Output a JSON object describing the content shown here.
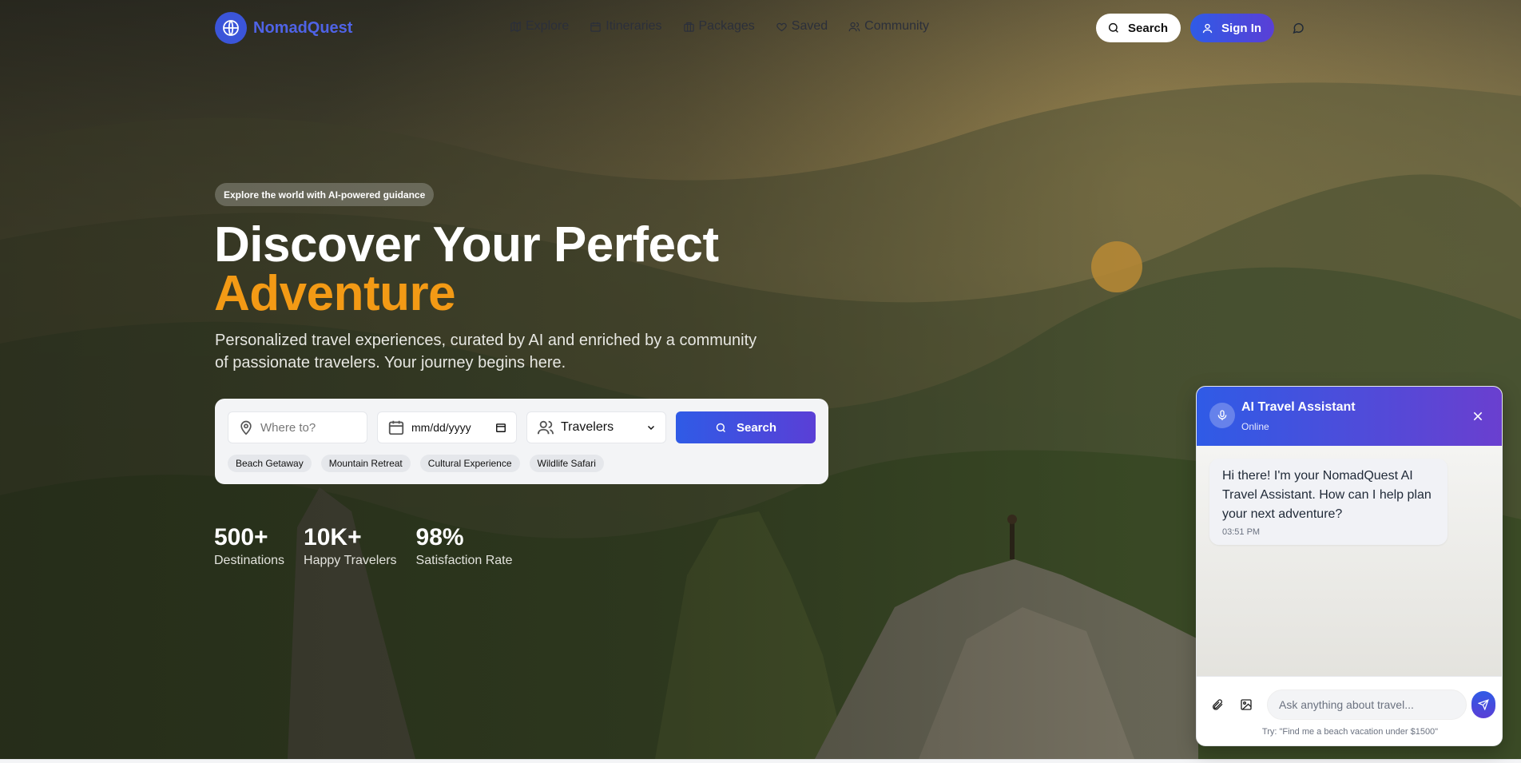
{
  "brand": {
    "name": "NomadQuest"
  },
  "nav": {
    "links": [
      {
        "label": "Explore",
        "icon": "map-icon"
      },
      {
        "label": "Itineraries",
        "icon": "calendar-icon"
      },
      {
        "label": "Packages",
        "icon": "briefcase-icon"
      },
      {
        "label": "Saved",
        "icon": "heart-icon"
      },
      {
        "label": "Community",
        "icon": "users-icon"
      }
    ],
    "search_label": "Search",
    "signin_label": "Sign In"
  },
  "hero": {
    "tagline": "Explore the world with AI-powered guidance",
    "headline_line1": "Discover Your Perfect",
    "headline_accent": "Adventure",
    "subhead": "Personalized travel experiences, curated by AI and enriched by a community of passionate travelers. Your journey begins here.",
    "accent_color": "#f39a15"
  },
  "search": {
    "where_placeholder": "Where to?",
    "date_placeholder": "mm/dd/yyyy",
    "travelers_value": "Travelers",
    "button_label": "Search",
    "chips": [
      "Beach Getaway",
      "Mountain Retreat",
      "Cultural Experience",
      "Wildlife Safari"
    ]
  },
  "stats": [
    {
      "value": "500+",
      "label": "Destinations"
    },
    {
      "value": "10K+",
      "label": "Happy Travelers"
    },
    {
      "value": "98%",
      "label": "Satisfaction Rate"
    }
  ],
  "chat": {
    "title": "AI Travel Assistant",
    "status": "Online",
    "message": "Hi there! I'm your NomadQuest AI Travel Assistant. How can I help plan your next adventure?",
    "message_time": "03:51 PM",
    "input_placeholder": "Ask anything about travel...",
    "hint": "Try: \"Find me a beach vacation under $1500\""
  },
  "colors": {
    "primary": "#2f5be6",
    "secondary": "#5a3fd6",
    "accent": "#f39a15"
  }
}
